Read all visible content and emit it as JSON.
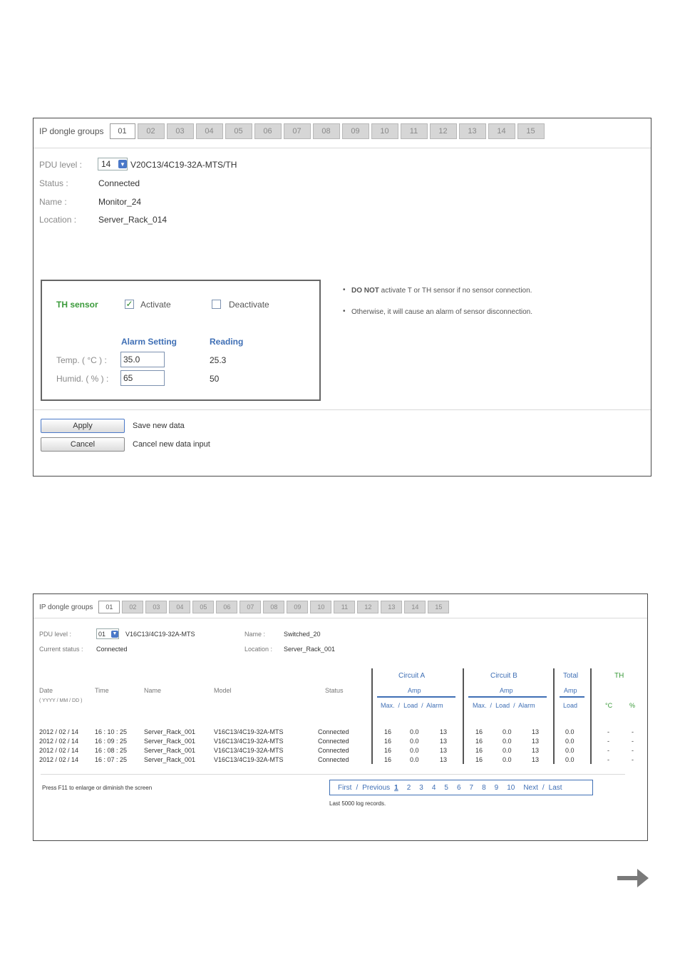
{
  "panel1": {
    "groups_label": "IP dongle groups",
    "groups": [
      "01",
      "02",
      "03",
      "04",
      "05",
      "06",
      "07",
      "08",
      "09",
      "10",
      "11",
      "12",
      "13",
      "14",
      "15"
    ],
    "active_group": "01",
    "pdu_level_label": "PDU level :",
    "pdu_level_value": "14",
    "pdu_model": "V20C13/4C19-32A-MTS/TH",
    "status_label": "Status :",
    "status_value": "Connected",
    "name_label": "Name :",
    "name_value": "Monitor_24",
    "location_label": "Location :",
    "location_value": "Server_Rack_014",
    "sensor": {
      "title": "TH sensor",
      "activate_label": "Activate",
      "activate_checked": true,
      "deactivate_label": "Deactivate",
      "deactivate_checked": false,
      "alarm_header": "Alarm Setting",
      "reading_header": "Reading",
      "temp_label": "Temp. ( °C ) :",
      "temp_alarm": "35.0",
      "temp_reading": "25.3",
      "humid_label": "Humid. ( % ) :",
      "humid_alarm": "65",
      "humid_reading": "50"
    },
    "notes": {
      "note1_bold": "DO NOT",
      "note1_rest": " activate T or TH sensor if no sensor connection.",
      "note2": "Otherwise, it will cause an alarm of sensor disconnection."
    },
    "apply_label": "Apply",
    "apply_note": "Save new data",
    "cancel_label": "Cancel",
    "cancel_note": "Cancel new data input"
  },
  "panel2": {
    "groups_label": "IP dongle groups",
    "groups": [
      "01",
      "02",
      "03",
      "04",
      "05",
      "06",
      "07",
      "08",
      "09",
      "10",
      "11",
      "12",
      "13",
      "14",
      "15"
    ],
    "active_group": "01",
    "pdu_level_label": "PDU level :",
    "pdu_level_value": "01",
    "pdu_model": "V16C13/4C19-32A-MTS",
    "current_status_label": "Current status :",
    "current_status_value": "Connected",
    "name_label": "Name :",
    "name_value": "Switched_20",
    "location_label": "Location :",
    "location_value": "Server_Rack_001",
    "columns": {
      "date": "Date",
      "date_format": "( YYYY / MM / DD )",
      "time": "Time",
      "name": "Name",
      "model": "Model",
      "status": "Status",
      "circuit_a": "Circuit  A",
      "circuit_b": "Circuit  B",
      "total": "Total",
      "th": "TH",
      "amp": "Amp",
      "max": "Max.",
      "slash1": "/",
      "load": "Load",
      "slash2": "/",
      "alarm": "Alarm",
      "total_load": "Load",
      "deg_c": "°C",
      "percent": "%"
    },
    "rows": [
      {
        "date": "2012 / 02 / 14",
        "time": "16 : 10 : 25",
        "name": "Server_Rack_001",
        "model": "V16C13/4C19-32A-MTS",
        "status": "Connected",
        "a_max": "16",
        "a_load": "0.0",
        "a_alarm": "13",
        "b_max": "16",
        "b_load": "0.0",
        "b_alarm": "13",
        "total": "0.0",
        "t": "-",
        "h": "-"
      },
      {
        "date": "2012 / 02 / 14",
        "time": "16 : 09 : 25",
        "name": "Server_Rack_001",
        "model": "V16C13/4C19-32A-MTS",
        "status": "Connected",
        "a_max": "16",
        "a_load": "0.0",
        "a_alarm": "13",
        "b_max": "16",
        "b_load": "0.0",
        "b_alarm": "13",
        "total": "0.0",
        "t": "-",
        "h": "-"
      },
      {
        "date": "2012 / 02 / 14",
        "time": "16 : 08 : 25",
        "name": "Server_Rack_001",
        "model": "V16C13/4C19-32A-MTS",
        "status": "Connected",
        "a_max": "16",
        "a_load": "0.0",
        "a_alarm": "13",
        "b_max": "16",
        "b_load": "0.0",
        "b_alarm": "13",
        "total": "0.0",
        "t": "-",
        "h": "-"
      },
      {
        "date": "2012 / 02 / 14",
        "time": "16 : 07 : 25",
        "name": "Server_Rack_001",
        "model": "V16C13/4C19-32A-MTS",
        "status": "Connected",
        "a_max": "16",
        "a_load": "0.0",
        "a_alarm": "13",
        "b_max": "16",
        "b_load": "0.0",
        "b_alarm": "13",
        "total": "0.0",
        "t": "-",
        "h": "-"
      }
    ],
    "f11_note": "Press F11 to enlarge or diminish the screen",
    "pager": {
      "first": "First",
      "slash1": "/",
      "previous": "Previous",
      "pages": [
        "1",
        "2",
        "3",
        "4",
        "5",
        "6",
        "7",
        "8",
        "9",
        "10"
      ],
      "current": "1",
      "next": "Next",
      "slash2": "/",
      "last": "Last"
    },
    "log_note": "Last 5000 log records."
  },
  "next_arrow_icon": "arrow-right-icon"
}
